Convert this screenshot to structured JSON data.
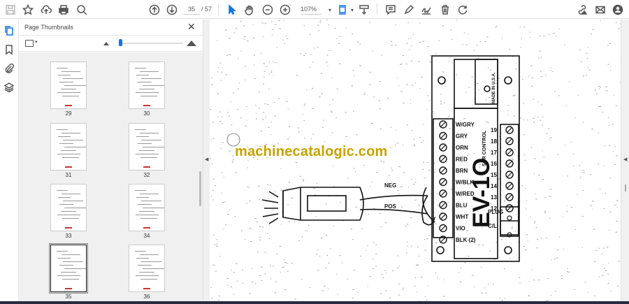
{
  "toolbar": {
    "icons": [
      "save-icon",
      "star-icon",
      "upload-cloud-icon",
      "print-icon",
      "search-zoom-icon",
      "page-up-icon",
      "page-down-icon",
      "select-cursor-icon",
      "hand-icon",
      "zoom-out-icon",
      "zoom-in-icon",
      "fit-page-icon",
      "scroll-mode-icon",
      "comment-icon",
      "highlight-pen-icon",
      "sign-icon",
      "delete-icon",
      "rotate-icon",
      "share-link-icon",
      "email-icon",
      "account-icon"
    ],
    "current_page": "35",
    "total_pages": "/ 57",
    "zoom": "107%"
  },
  "panel": {
    "title": "Page Thumbnails",
    "thumbnail_size": 0.05,
    "thumbnails": [
      {
        "label": "29"
      },
      {
        "label": "30"
      },
      {
        "label": "31"
      },
      {
        "label": "32"
      },
      {
        "label": "33"
      },
      {
        "label": "34"
      },
      {
        "label": "35"
      },
      {
        "label": "36"
      }
    ],
    "selected": "35"
  },
  "document": {
    "watermark": "machinecatalogic.com",
    "diagram": {
      "neg": "NEG",
      "pos": "POS",
      "left_labels": [
        "W/GRY",
        "GRY",
        "ORN",
        "RED",
        "BRN",
        "W/BLK",
        "W/RED",
        "BLU",
        "WHT",
        "VIO",
        "BLK (2)"
      ],
      "right_labels": [
        "19",
        "18",
        "17",
        "16",
        "15",
        "14",
        "13",
        "12",
        "PLUG",
        "C/L"
      ],
      "model": "EV-1",
      "model_suffix": "O",
      "control": "SCR CONTROL",
      "made_in": "MADE IN U.S.A."
    }
  }
}
